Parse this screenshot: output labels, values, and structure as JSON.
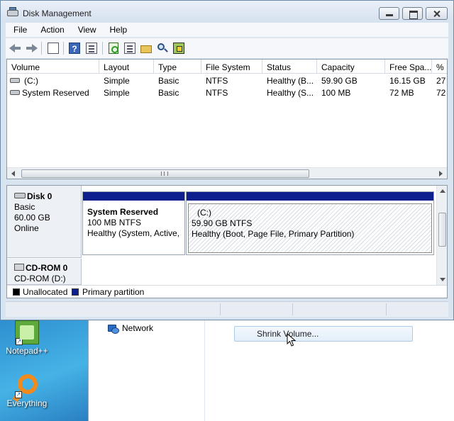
{
  "window": {
    "title": "Disk Management",
    "controls": {
      "minimize": "minimize",
      "maximize": "maximize",
      "close": "close"
    }
  },
  "menubar": {
    "items": [
      {
        "label": "File"
      },
      {
        "label": "Action"
      },
      {
        "label": "View"
      },
      {
        "label": "Help"
      }
    ]
  },
  "toolbar": {
    "buttons": [
      "back-icon",
      "forward-icon",
      "console-tree-icon",
      "help-icon",
      "show-hide-icon",
      "refresh-icon",
      "properties-icon",
      "open-folder-icon",
      "search-icon",
      "settings-icon"
    ]
  },
  "volume_list": {
    "columns": [
      "Volume",
      "Layout",
      "Type",
      "File System",
      "Status",
      "Capacity",
      "Free Spa...",
      "% F"
    ],
    "rows": [
      {
        "volume": "(C:)",
        "layout": "Simple",
        "type": "Basic",
        "file_system": "NTFS",
        "status": "Healthy (B...",
        "capacity": "59.90 GB",
        "free_space": "16.15 GB",
        "percent_free": "27"
      },
      {
        "volume": "System Reserved",
        "layout": "Simple",
        "type": "Basic",
        "file_system": "NTFS",
        "status": "Healthy (S...",
        "capacity": "100 MB",
        "free_space": "72 MB",
        "percent_free": "72"
      }
    ],
    "hscroll_grip": "III"
  },
  "disk_map": {
    "disk0": {
      "name": "Disk 0",
      "type": "Basic",
      "size": "60.00 GB",
      "state": "Online",
      "partitions": [
        {
          "name": "System Reserved",
          "size_fs": "100 MB NTFS",
          "status": "Healthy (System, Active,"
        },
        {
          "name": "(C:)",
          "size_fs": "59.90 GB NTFS",
          "status": "Healthy (Boot, Page File, Primary Partition)"
        }
      ]
    },
    "cdrom0": {
      "name": "CD-ROM 0",
      "drive": "CD-ROM (D:)"
    },
    "legend": [
      {
        "label": "Unallocated",
        "color": "#000000"
      },
      {
        "label": "Primary partition",
        "color": "#0d1f8c"
      }
    ]
  },
  "background": {
    "explorer_nav_network": "Network",
    "context_menu_item": "Shrink Volume...",
    "desktop_icons": [
      {
        "label": "Notepad++"
      },
      {
        "label": "Everything"
      }
    ]
  },
  "colors": {
    "primary_partition": "#0d1f8c",
    "titlebar": "#d9e4f1",
    "desktop": "#3aa0d8"
  }
}
